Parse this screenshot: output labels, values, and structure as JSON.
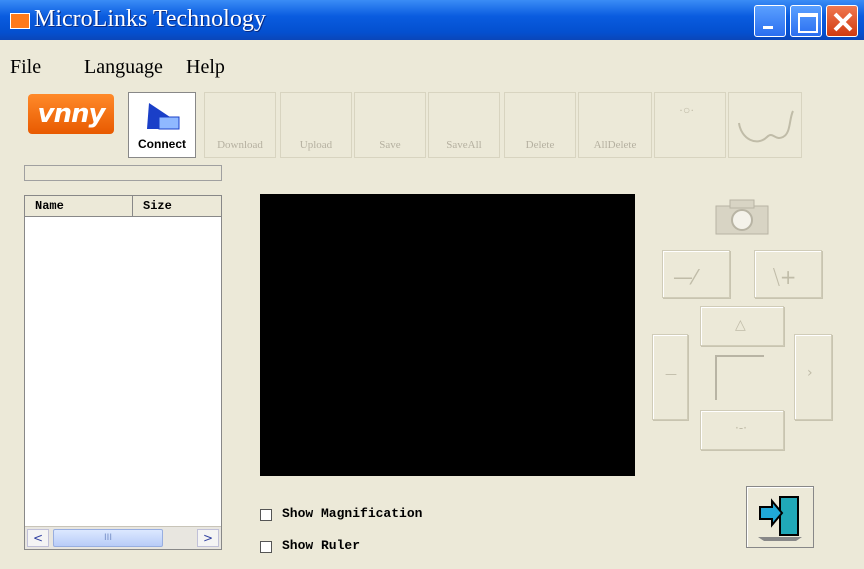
{
  "window": {
    "title": "MicroLinks Technology"
  },
  "menu": [
    "File",
    "Language",
    "Help"
  ],
  "toolbar": {
    "logo_text": "vnny",
    "connect_label": "Connect",
    "disabled_buttons": [
      "Download",
      "Upload",
      "Save",
      "SaveAll",
      "Delete",
      "AllDelete"
    ]
  },
  "filelist": {
    "col_name": "Name",
    "col_size": "Size",
    "scroll_thumb": "III"
  },
  "options": {
    "show_magnification": "Show Magnification",
    "show_ruler": "Show Ruler"
  },
  "colors": {
    "titlebar": "#0a5ce0",
    "logo": "#ff7a1a",
    "video_bg": "#000000"
  }
}
